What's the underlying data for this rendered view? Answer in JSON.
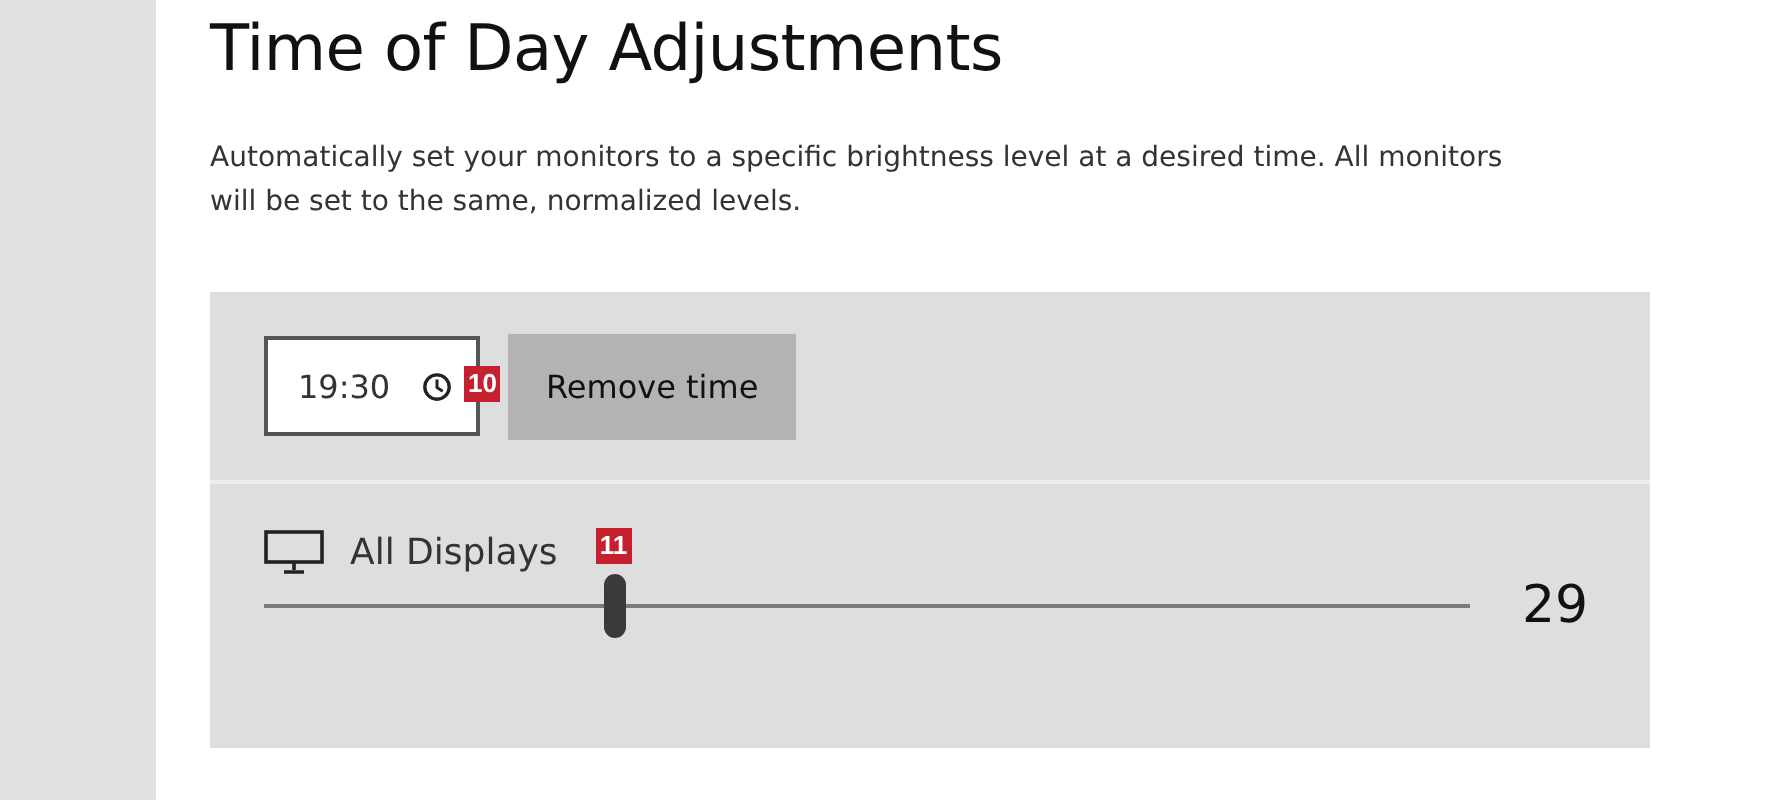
{
  "title": "Time of Day Adjustments",
  "description": "Automatically set your monitors to a specific brightness level at a desired time. All monitors will be set to the same, normalized levels.",
  "time_entry": {
    "value": "19:30",
    "badge": "10",
    "remove_button": "Remove time"
  },
  "display": {
    "label": "All Displays",
    "badge": "11",
    "level": 0.29,
    "reading": "29"
  }
}
